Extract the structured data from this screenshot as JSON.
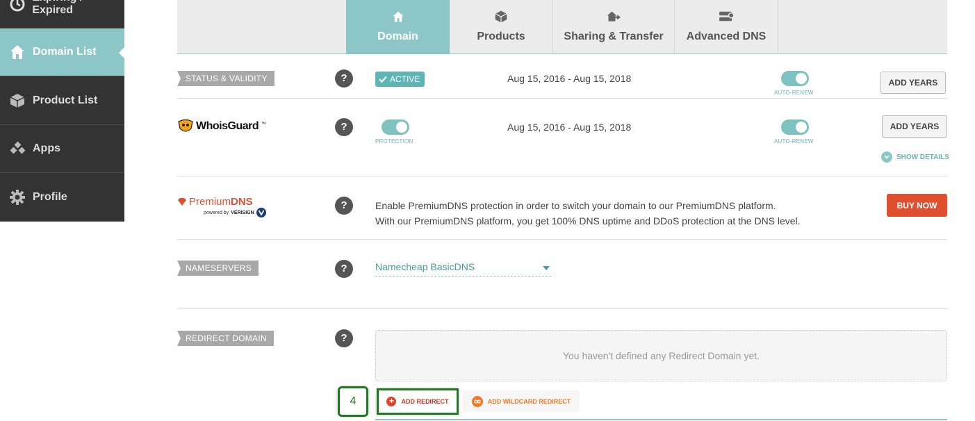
{
  "sidebar": {
    "items": [
      {
        "label": "Expiring / Expired",
        "icon": "clock-icon"
      },
      {
        "label": "Domain List",
        "icon": "home-icon"
      },
      {
        "label": "Product List",
        "icon": "box-icon"
      },
      {
        "label": "Apps",
        "icon": "apps-icon"
      },
      {
        "label": "Profile",
        "icon": "gear-icon"
      }
    ]
  },
  "tabs": [
    {
      "label": "Domain",
      "icon": "home-icon"
    },
    {
      "label": "Products",
      "icon": "box-icon"
    },
    {
      "label": "Sharing & Transfer",
      "icon": "share-icon"
    },
    {
      "label": "Advanced DNS",
      "icon": "server-icon"
    }
  ],
  "status": {
    "tag": "STATUS & VALIDITY",
    "badge": "ACTIVE",
    "dates": "Aug 15, 2016 - Aug 15, 2018",
    "toggle_caption": "AUTO-RENEW",
    "add_years": "ADD YEARS"
  },
  "whoisguard": {
    "logo_text": "WhoisGuard",
    "tm": "™",
    "protection_caption": "PROTECTION",
    "dates": "Aug 15, 2016 - Aug 15, 2018",
    "toggle_caption": "AUTO-RENEW",
    "add_years": "ADD YEARS",
    "show_details": "SHOW DETAILS"
  },
  "premiumdns": {
    "logo_premium": "Premium",
    "logo_dns": "DNS",
    "powered_by": "powered by",
    "verisign": "VERISIGN",
    "desc_line1": "Enable PremiumDNS protection in order to switch your domain to our PremiumDNS platform.",
    "desc_line2": "With our PremiumDNS platform, you get 100% DNS uptime and DDoS protection at the DNS level.",
    "buy_now": "BUY NOW"
  },
  "nameservers": {
    "tag": "NAMESERVERS",
    "selected": "Namecheap BasicDNS"
  },
  "redirect": {
    "tag": "REDIRECT DOMAIN",
    "empty_text": "You haven't defined any Redirect Domain yet.",
    "add_redirect": "ADD REDIRECT",
    "add_wildcard": "ADD WILDCARD REDIRECT",
    "step_number": "4"
  },
  "help_mark": "?",
  "colors": {
    "accent": "#8cc6c6",
    "sidebar_bg": "#333333",
    "buy_now": "#e0502f",
    "step_marker": "#1f7a1f"
  }
}
